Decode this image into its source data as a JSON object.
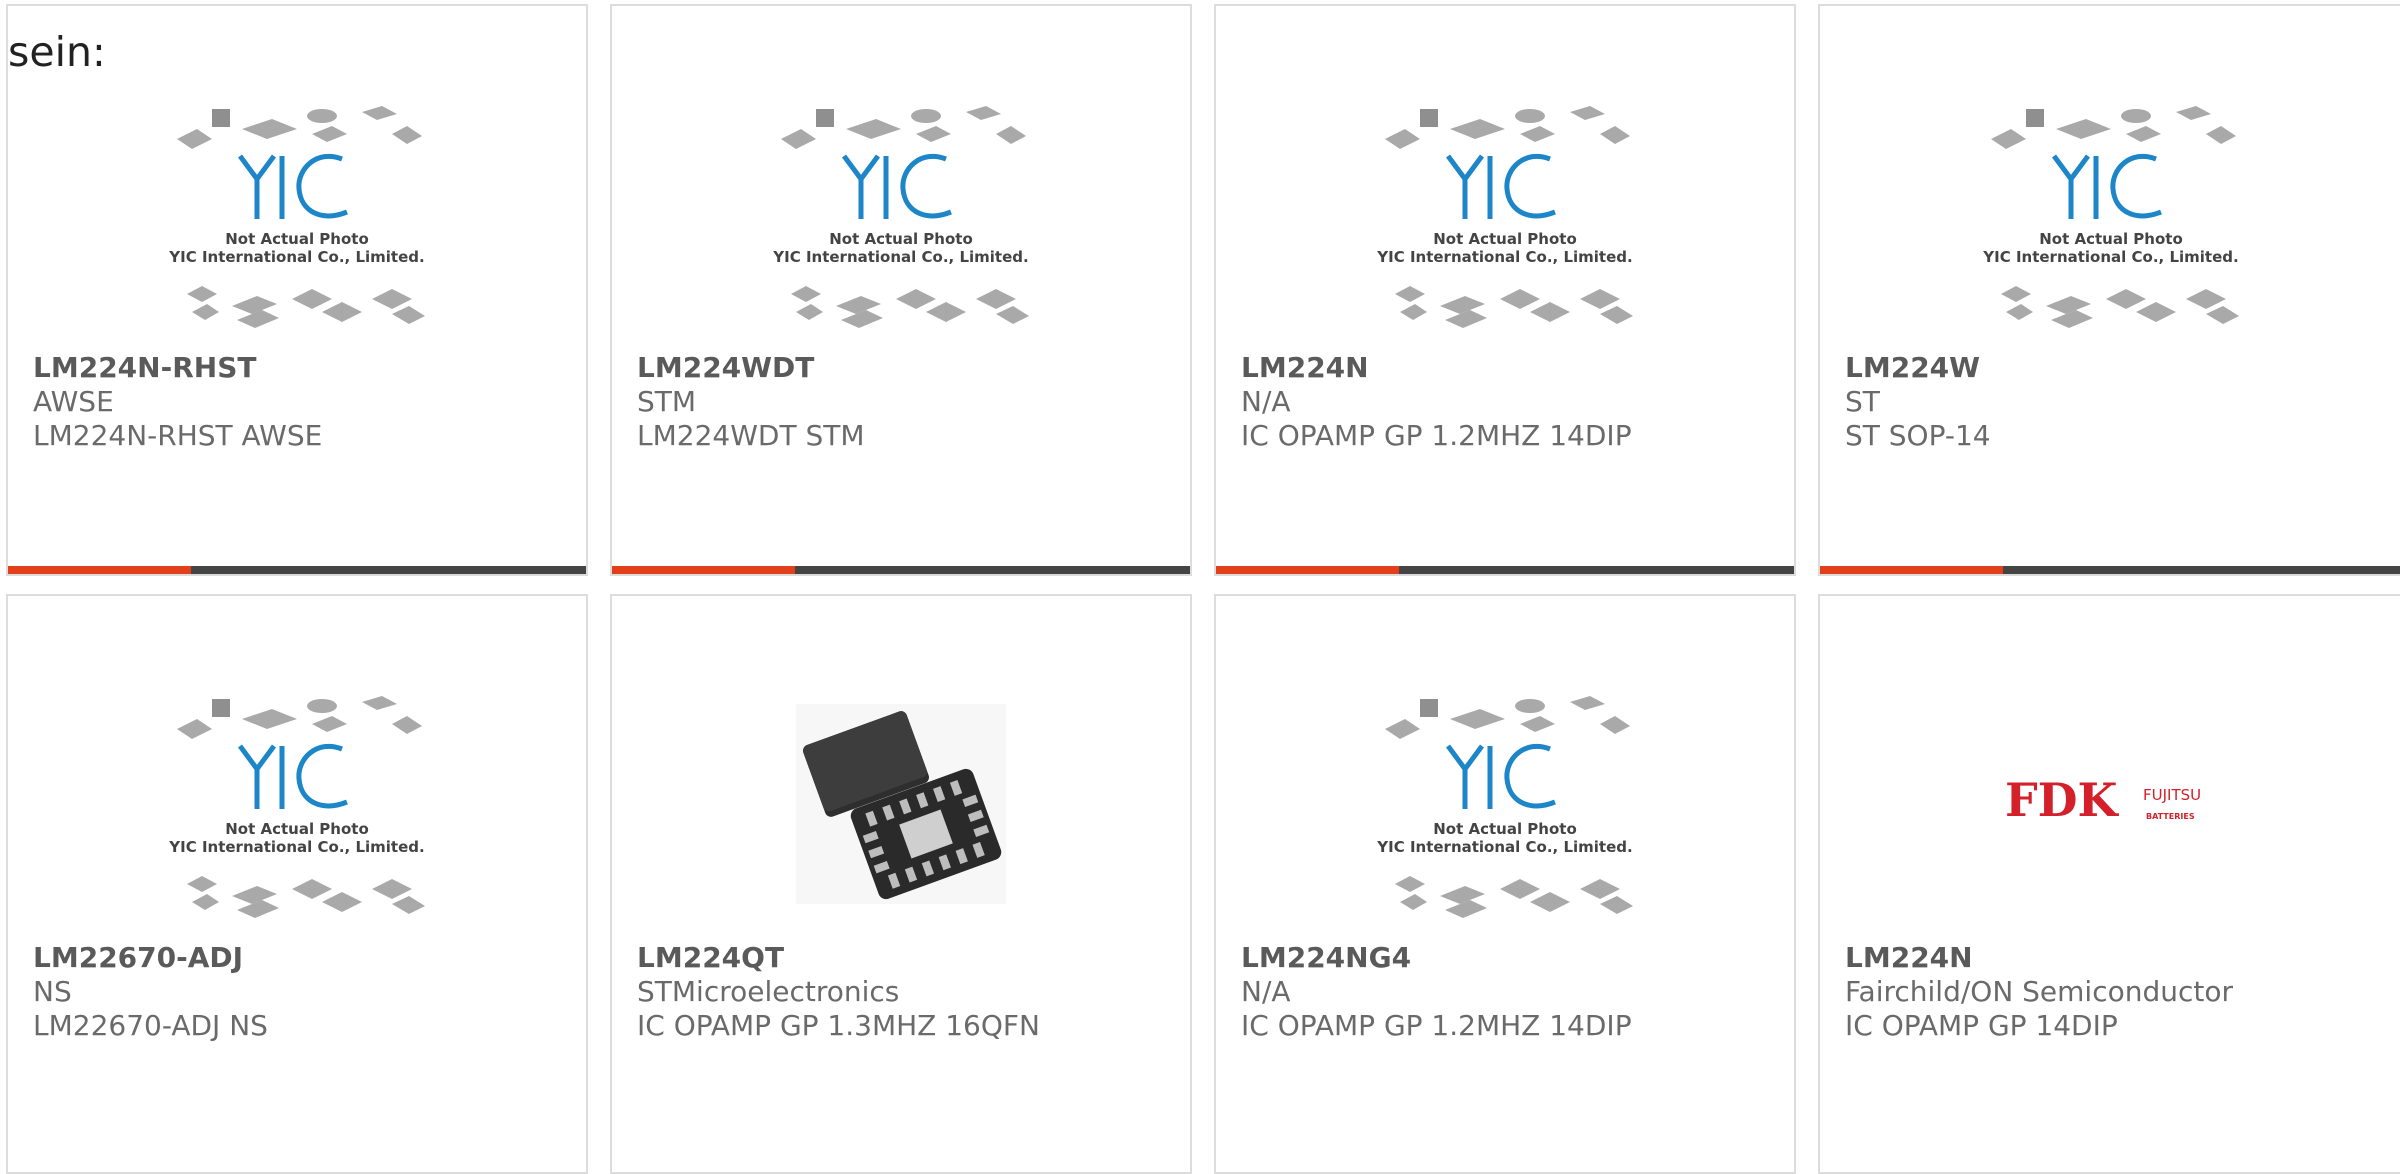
{
  "page": {
    "fragment_label": "sein:"
  },
  "placeholder": {
    "logo_text": "YIC",
    "line1": "Not Actual Photo",
    "line2": "YIC International Co., Limited."
  },
  "colors": {
    "accent": "#e1401a",
    "bar": "#444444",
    "border": "#dcdcdc",
    "yic_blue": "#1c86c9",
    "fdk_red": "#d4202a"
  },
  "products": [
    {
      "part": "LM224N-RHST",
      "manufacturer": "AWSE",
      "description": "LM224N-RHST AWSE",
      "image": "yic-placeholder"
    },
    {
      "part": "LM224WDT",
      "manufacturer": "STM",
      "description": "LM224WDT STM",
      "image": "yic-placeholder"
    },
    {
      "part": "LM224N",
      "manufacturer": "N/A",
      "description": "IC OPAMP GP 1.2MHZ 14DIP",
      "image": "yic-placeholder"
    },
    {
      "part": "LM224W",
      "manufacturer": "ST",
      "description": "ST SOP-14",
      "image": "yic-placeholder"
    },
    {
      "part": "LM22670-ADJ",
      "manufacturer": "NS",
      "description": "LM22670-ADJ NS",
      "image": "yic-placeholder"
    },
    {
      "part": "LM224QT",
      "manufacturer": "STMicroelectronics",
      "description": "IC OPAMP GP 1.3MHZ 16QFN",
      "image": "qfn-chip-photo"
    },
    {
      "part": "LM224NG4",
      "manufacturer": "N/A",
      "description": "IC OPAMP GP 1.2MHZ 14DIP",
      "image": "yic-placeholder"
    },
    {
      "part": "LM224N",
      "manufacturer": "Fairchild/ON Semiconductor",
      "description": "IC OPAMP GP 14DIP",
      "image": "fdk-fujitsu-logo"
    }
  ],
  "fdk_logo": {
    "brand": "FDK",
    "sub1": "FUJITSU",
    "sub2": "BATTERIES"
  }
}
